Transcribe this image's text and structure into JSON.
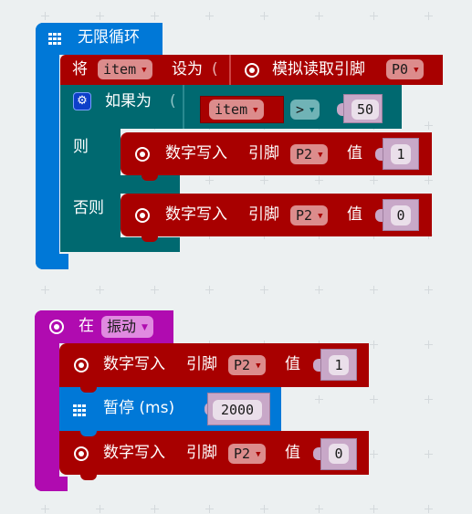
{
  "workspace": {
    "background": "#ecf0f1"
  },
  "colors": {
    "loops": "#0078d7",
    "pins": "#a80000",
    "logic": "#006970",
    "input": "#b00bb0",
    "number_slot": "#c8a8c8"
  },
  "forever_block": {
    "icon": "grid-icon",
    "label": "无限循环",
    "set_block": {
      "prefix": "将",
      "variable": "item",
      "suffix": "设为",
      "reporter": {
        "icon": "pin-target-icon",
        "label": "模拟读取引脚",
        "pin": "P0"
      }
    },
    "if_block": {
      "icon": "gear-icon",
      "if_label": "如果为",
      "condition": {
        "left": "item",
        "operator": ">",
        "right": "50"
      },
      "then_label": "则",
      "else_label": "否则",
      "then_action": {
        "icon": "pin-target-icon",
        "label": "数字写入",
        "pin_label": "引脚",
        "pin": "P2",
        "value_label": "值",
        "value": "1"
      },
      "else_action": {
        "icon": "pin-target-icon",
        "label": "数字写入",
        "pin_label": "引脚",
        "pin": "P2",
        "value_label": "值",
        "value": "0"
      }
    }
  },
  "event_block": {
    "icon": "radio-target-icon",
    "label": "在",
    "event": "振动",
    "actions": [
      {
        "icon": "pin-target-icon",
        "label": "数字写入",
        "pin_label": "引脚",
        "pin": "P2",
        "value_label": "值",
        "value": "1"
      },
      {
        "icon": "grid-icon",
        "label": "暂停 (ms)",
        "value": "2000"
      },
      {
        "icon": "pin-target-icon",
        "label": "数字写入",
        "pin_label": "引脚",
        "pin": "P2",
        "value_label": "值",
        "value": "0"
      }
    ]
  }
}
